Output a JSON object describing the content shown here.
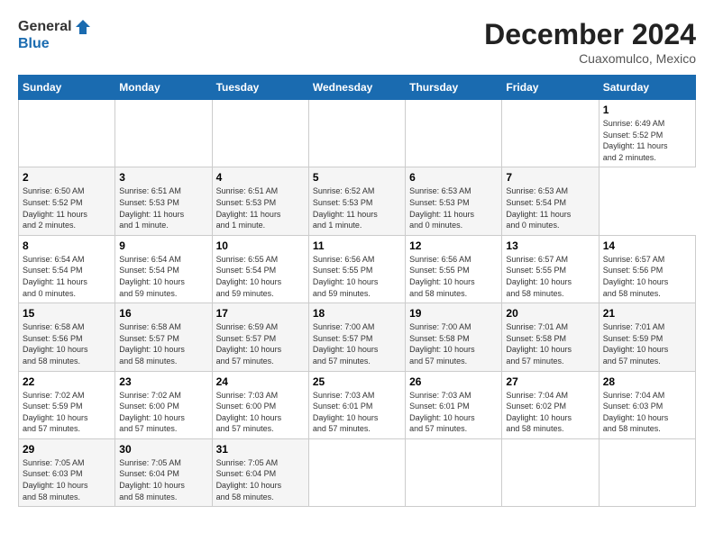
{
  "header": {
    "logo_general": "General",
    "logo_blue": "Blue",
    "month_title": "December 2024",
    "location": "Cuaxomulco, Mexico"
  },
  "calendar": {
    "days_of_week": [
      "Sunday",
      "Monday",
      "Tuesday",
      "Wednesday",
      "Thursday",
      "Friday",
      "Saturday"
    ],
    "weeks": [
      [
        {
          "day": "",
          "info": ""
        },
        {
          "day": "",
          "info": ""
        },
        {
          "day": "",
          "info": ""
        },
        {
          "day": "",
          "info": ""
        },
        {
          "day": "",
          "info": ""
        },
        {
          "day": "",
          "info": ""
        },
        {
          "day": "1",
          "info": "Sunrise: 6:49 AM\nSunset: 5:52 PM\nDaylight: 11 hours\nand 2 minutes."
        }
      ],
      [
        {
          "day": "2",
          "info": "Sunrise: 6:50 AM\nSunset: 5:52 PM\nDaylight: 11 hours\nand 2 minutes."
        },
        {
          "day": "3",
          "info": "Sunrise: 6:51 AM\nSunset: 5:53 PM\nDaylight: 11 hours\nand 1 minute."
        },
        {
          "day": "4",
          "info": "Sunrise: 6:51 AM\nSunset: 5:53 PM\nDaylight: 11 hours\nand 1 minute."
        },
        {
          "day": "5",
          "info": "Sunrise: 6:52 AM\nSunset: 5:53 PM\nDaylight: 11 hours\nand 1 minute."
        },
        {
          "day": "6",
          "info": "Sunrise: 6:53 AM\nSunset: 5:53 PM\nDaylight: 11 hours\nand 0 minutes."
        },
        {
          "day": "7",
          "info": "Sunrise: 6:53 AM\nSunset: 5:54 PM\nDaylight: 11 hours\nand 0 minutes."
        }
      ],
      [
        {
          "day": "8",
          "info": "Sunrise: 6:54 AM\nSunset: 5:54 PM\nDaylight: 11 hours\nand 0 minutes."
        },
        {
          "day": "9",
          "info": "Sunrise: 6:54 AM\nSunset: 5:54 PM\nDaylight: 10 hours\nand 59 minutes."
        },
        {
          "day": "10",
          "info": "Sunrise: 6:55 AM\nSunset: 5:54 PM\nDaylight: 10 hours\nand 59 minutes."
        },
        {
          "day": "11",
          "info": "Sunrise: 6:56 AM\nSunset: 5:55 PM\nDaylight: 10 hours\nand 59 minutes."
        },
        {
          "day": "12",
          "info": "Sunrise: 6:56 AM\nSunset: 5:55 PM\nDaylight: 10 hours\nand 58 minutes."
        },
        {
          "day": "13",
          "info": "Sunrise: 6:57 AM\nSunset: 5:55 PM\nDaylight: 10 hours\nand 58 minutes."
        },
        {
          "day": "14",
          "info": "Sunrise: 6:57 AM\nSunset: 5:56 PM\nDaylight: 10 hours\nand 58 minutes."
        }
      ],
      [
        {
          "day": "15",
          "info": "Sunrise: 6:58 AM\nSunset: 5:56 PM\nDaylight: 10 hours\nand 58 minutes."
        },
        {
          "day": "16",
          "info": "Sunrise: 6:58 AM\nSunset: 5:57 PM\nDaylight: 10 hours\nand 58 minutes."
        },
        {
          "day": "17",
          "info": "Sunrise: 6:59 AM\nSunset: 5:57 PM\nDaylight: 10 hours\nand 57 minutes."
        },
        {
          "day": "18",
          "info": "Sunrise: 7:00 AM\nSunset: 5:57 PM\nDaylight: 10 hours\nand 57 minutes."
        },
        {
          "day": "19",
          "info": "Sunrise: 7:00 AM\nSunset: 5:58 PM\nDaylight: 10 hours\nand 57 minutes."
        },
        {
          "day": "20",
          "info": "Sunrise: 7:01 AM\nSunset: 5:58 PM\nDaylight: 10 hours\nand 57 minutes."
        },
        {
          "day": "21",
          "info": "Sunrise: 7:01 AM\nSunset: 5:59 PM\nDaylight: 10 hours\nand 57 minutes."
        }
      ],
      [
        {
          "day": "22",
          "info": "Sunrise: 7:02 AM\nSunset: 5:59 PM\nDaylight: 10 hours\nand 57 minutes."
        },
        {
          "day": "23",
          "info": "Sunrise: 7:02 AM\nSunset: 6:00 PM\nDaylight: 10 hours\nand 57 minutes."
        },
        {
          "day": "24",
          "info": "Sunrise: 7:03 AM\nSunset: 6:00 PM\nDaylight: 10 hours\nand 57 minutes."
        },
        {
          "day": "25",
          "info": "Sunrise: 7:03 AM\nSunset: 6:01 PM\nDaylight: 10 hours\nand 57 minutes."
        },
        {
          "day": "26",
          "info": "Sunrise: 7:03 AM\nSunset: 6:01 PM\nDaylight: 10 hours\nand 57 minutes."
        },
        {
          "day": "27",
          "info": "Sunrise: 7:04 AM\nSunset: 6:02 PM\nDaylight: 10 hours\nand 58 minutes."
        },
        {
          "day": "28",
          "info": "Sunrise: 7:04 AM\nSunset: 6:03 PM\nDaylight: 10 hours\nand 58 minutes."
        }
      ],
      [
        {
          "day": "29",
          "info": "Sunrise: 7:05 AM\nSunset: 6:03 PM\nDaylight: 10 hours\nand 58 minutes."
        },
        {
          "day": "30",
          "info": "Sunrise: 7:05 AM\nSunset: 6:04 PM\nDaylight: 10 hours\nand 58 minutes."
        },
        {
          "day": "31",
          "info": "Sunrise: 7:05 AM\nSunset: 6:04 PM\nDaylight: 10 hours\nand 58 minutes."
        },
        {
          "day": "",
          "info": ""
        },
        {
          "day": "",
          "info": ""
        },
        {
          "day": "",
          "info": ""
        },
        {
          "day": "",
          "info": ""
        }
      ]
    ]
  }
}
